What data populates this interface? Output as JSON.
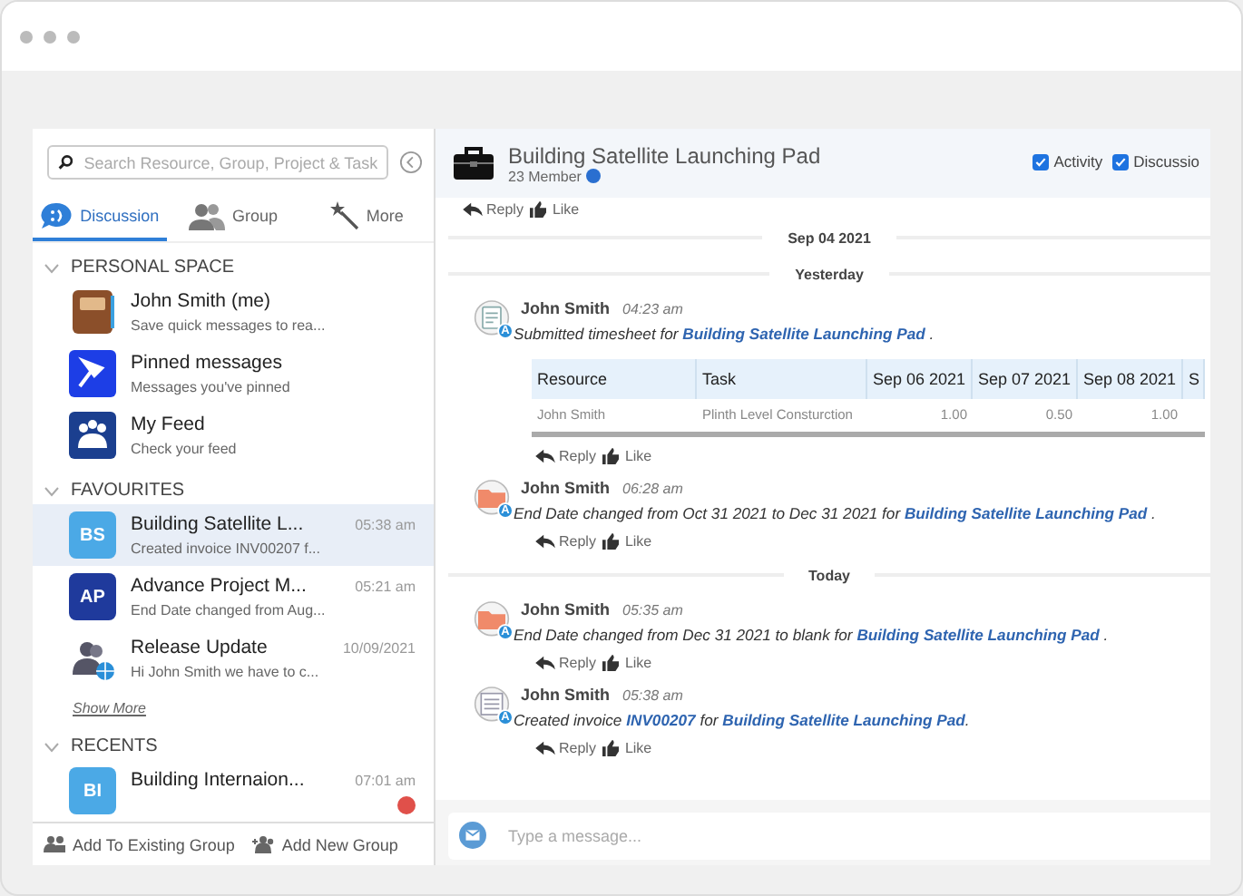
{
  "search": {
    "placeholder": "Search Resource, Group, Project & Task"
  },
  "tabs": [
    {
      "label": "Discussion",
      "selected": true
    },
    {
      "label": "Group",
      "selected": false
    },
    {
      "label": "More",
      "selected": false
    }
  ],
  "sections": [
    {
      "title": "PERSONAL SPACE",
      "expanded": true,
      "items": [
        {
          "kind": "notebook",
          "name": "John Smith (me)",
          "preview": "Save quick messages to rea...",
          "selected": false
        },
        {
          "kind": "pin",
          "name": "Pinned messages",
          "preview": "Messages you've pinned",
          "selected": false
        },
        {
          "kind": "feed",
          "name": "My Feed",
          "preview": "Check your feed",
          "selected": false
        }
      ]
    },
    {
      "title": "FAVOURITES",
      "expanded": true,
      "show_more": "Show More",
      "items": [
        {
          "kind": "initials",
          "initials": "BS",
          "color": "#4ba9e6",
          "name": "Building Satellite L...",
          "time": "05:38 am",
          "preview": "Created invoice INV00207 f...",
          "selected": true
        },
        {
          "kind": "initials",
          "initials": "AP",
          "color": "#1f3a9c",
          "name": "Advance Project M...",
          "time": "05:21 am",
          "preview": "End Date changed from Aug...",
          "selected": false
        },
        {
          "kind": "group",
          "name": "Release Update",
          "time": "10/09/2021",
          "preview": "Hi John Smith we have to c...",
          "selected": false
        }
      ]
    },
    {
      "title": "RECENTS",
      "expanded": true,
      "items": [
        {
          "kind": "initials",
          "initials": "BI",
          "color": "#4ba9e6",
          "name": "Building Internaion...",
          "time": "07:01 am",
          "selected": false,
          "unread": true
        }
      ]
    }
  ],
  "footer_actions": [
    {
      "label": "Add To Existing Group"
    },
    {
      "label": "Add New Group"
    }
  ],
  "channel": {
    "title": "Building Satellite Launching Pad",
    "members": "23 Member",
    "filters": [
      {
        "label": "Activity",
        "checked": true
      },
      {
        "label": "Discussio",
        "checked": true
      }
    ]
  },
  "feed": [
    {
      "kind": "actions",
      "reply": "Reply",
      "like": "Like"
    },
    {
      "kind": "divider",
      "label": "Sep 04 2021"
    },
    {
      "kind": "divider",
      "label": "Yesterday"
    },
    {
      "kind": "message",
      "avatar": {
        "kind": "timesheet",
        "badge": "A"
      },
      "author": "John Smith",
      "time": "04:23 am",
      "parts": [
        {
          "text": "Submitted timesheet for "
        },
        {
          "link": "Building Satellite Launching Pad"
        },
        {
          "text": " ."
        }
      ],
      "table": {
        "columns": [
          "Resource",
          "Task",
          "Sep 06 2021",
          "Sep 07 2021",
          "Sep 08 2021",
          "S"
        ],
        "rows": [
          [
            "John Smith",
            "Plinth Level Consturction",
            "1.00",
            "0.50",
            "1.00"
          ]
        ]
      },
      "reply": "Reply",
      "like": "Like"
    },
    {
      "kind": "message",
      "avatar": {
        "kind": "folder",
        "badge": "A"
      },
      "author": "John Smith",
      "time": "06:28 am",
      "parts": [
        {
          "text": "End Date changed from Oct 31 2021 to Dec 31 2021 for "
        },
        {
          "link": "Building Satellite Launching Pad"
        },
        {
          "text": " ."
        }
      ],
      "reply": "Reply",
      "like": "Like"
    },
    {
      "kind": "divider",
      "label": "Today"
    },
    {
      "kind": "message",
      "avatar": {
        "kind": "folder",
        "badge": "A"
      },
      "author": "John Smith",
      "time": "05:35 am",
      "parts": [
        {
          "text": "End Date changed from Dec 31 2021 to blank for "
        },
        {
          "link": "Building Satellite Launching Pad"
        },
        {
          "text": " ."
        }
      ],
      "reply": "Reply",
      "like": "Like"
    },
    {
      "kind": "message",
      "avatar": {
        "kind": "invoice",
        "badge": "A"
      },
      "author": "John Smith",
      "time": "05:38 am",
      "parts": [
        {
          "text": "Created invoice "
        },
        {
          "link": "INV00207"
        },
        {
          "text": " for "
        },
        {
          "link": "Building Satellite Launching Pad"
        },
        {
          "text": "."
        }
      ],
      "reply": "Reply",
      "like": "Like"
    }
  ],
  "composer": {
    "placeholder": "Type a message..."
  }
}
